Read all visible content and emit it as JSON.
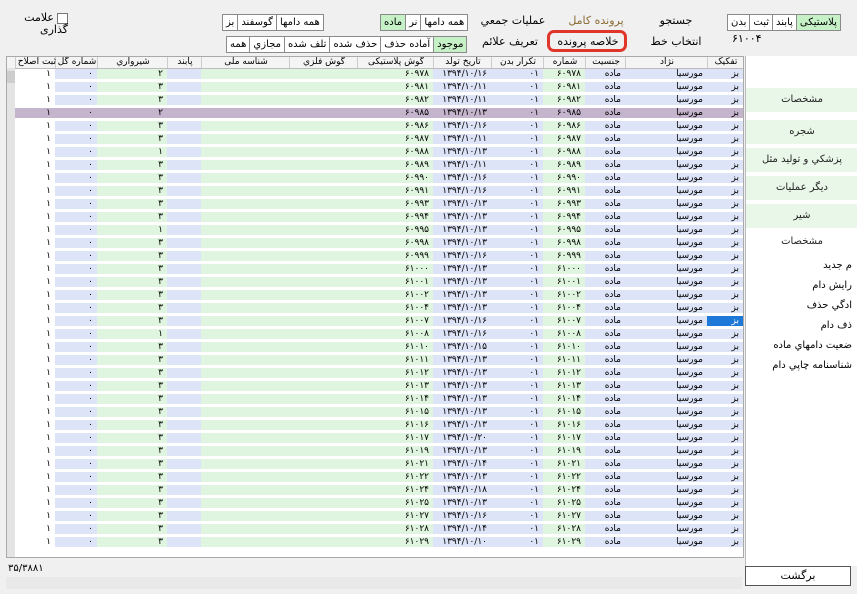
{
  "mark_checkbox": "علامت گذاری",
  "filters": {
    "herd": [
      {
        "label": "همه دامها",
        "selected": false
      },
      {
        "label": "نر",
        "selected": false
      },
      {
        "label": "ماده",
        "selected": true
      }
    ],
    "species": [
      {
        "label": "همه دامها",
        "selected": true
      },
      {
        "label": "گوسفند",
        "selected": false
      },
      {
        "label": "بز",
        "selected": false
      }
    ],
    "status": [
      {
        "label": "موجود",
        "selected": true
      },
      {
        "label": "آماده حذف",
        "selected": false
      },
      {
        "label": "حذف شده",
        "selected": false
      },
      {
        "label": "تلف شده",
        "selected": false
      },
      {
        "label": "مجازي",
        "selected": false
      },
      {
        "label": "همه",
        "selected": false
      }
    ],
    "tag_type": [
      {
        "label": "پلاستیکی",
        "selected": true
      },
      {
        "label": "پابند",
        "selected": false
      },
      {
        "label": "ثبت",
        "selected": false
      },
      {
        "label": "بدن",
        "selected": false
      }
    ]
  },
  "top_buttons": {
    "search": "جستجو",
    "full_record": "پرونده کامل",
    "bulk_ops": "عملیات جمعي",
    "select_line": "انتخاب خط",
    "record_summary": "خلاصه پرونده",
    "define_signs": "تعریف علائم"
  },
  "search_id": "۶۱۰۰۴",
  "columns": [
    "تفکیک",
    "نژاد",
    "جنسیت",
    "شماره",
    "تکرار بدن",
    "تاریخ تولد",
    "گوش پلاستیکی",
    "گوش فلزي",
    "شناسه ملی",
    "پابند",
    "شیرواري",
    "شماره گل",
    "ثبت اصلاح ..."
  ],
  "rows": [
    {
      "sp": "بز",
      "breed": "مورسیا",
      "sex": "ماده",
      "num": "۶۰۹۷۸",
      "rep": "۰۱",
      "birth": "۱۳۹۴/۱۰/۱۶",
      "plastic": "۶۰۹۷۸",
      "milk": "۲",
      "nose": "۰",
      "reg": "۱"
    },
    {
      "sp": "بز",
      "breed": "مورسیا",
      "sex": "ماده",
      "num": "۶۰۹۸۱",
      "rep": "۰۱",
      "birth": "۱۳۹۴/۱۰/۱۱",
      "plastic": "۶۰۹۸۱",
      "milk": "۳",
      "nose": "۰",
      "reg": "۱"
    },
    {
      "sp": "بز",
      "breed": "مورسیا",
      "sex": "ماده",
      "num": "۶۰۹۸۲",
      "rep": "۰۱",
      "birth": "۱۳۹۴/۱۰/۱۱",
      "plastic": "۶۰۹۸۲",
      "milk": "۳",
      "nose": "۰",
      "reg": "۱"
    },
    {
      "sp": "بز",
      "breed": "مورسیا",
      "sex": "ماده",
      "num": "۶۰۹۸۵",
      "rep": "۰۱",
      "birth": "۱۳۹۴/۱۰/۱۳",
      "plastic": "۶۰۹۸۵",
      "milk": "۲",
      "nose": "۰",
      "reg": "۱"
    },
    {
      "sp": "بز",
      "breed": "مورسیا",
      "sex": "ماده",
      "num": "۶۰۹۸۶",
      "rep": "۰۱",
      "birth": "۱۳۹۴/۱۰/۱۶",
      "plastic": "۶۰۹۸۶",
      "milk": "۳",
      "nose": "۰",
      "reg": "۱"
    },
    {
      "sp": "بز",
      "breed": "مورسیا",
      "sex": "ماده",
      "num": "۶۰۹۸۷",
      "rep": "۰۱",
      "birth": "۱۳۹۴/۱۰/۱۱",
      "plastic": "۶۰۹۸۷",
      "milk": "۳",
      "nose": "۰",
      "reg": "۱"
    },
    {
      "sp": "بز",
      "breed": "مورسیا",
      "sex": "ماده",
      "num": "۶۰۹۸۸",
      "rep": "۰۱",
      "birth": "۱۳۹۴/۱۰/۱۳",
      "plastic": "۶۰۹۸۸",
      "milk": "۱",
      "nose": "۰",
      "reg": "۱"
    },
    {
      "sp": "بز",
      "breed": "مورسیا",
      "sex": "ماده",
      "num": "۶۰۹۸۹",
      "rep": "۰۱",
      "birth": "۱۳۹۴/۱۰/۱۱",
      "plastic": "۶۰۹۸۹",
      "milk": "۳",
      "nose": "۰",
      "reg": "۱"
    },
    {
      "sp": "بز",
      "breed": "مورسیا",
      "sex": "ماده",
      "num": "۶۰۹۹۰",
      "rep": "۰۱",
      "birth": "۱۳۹۴/۱۰/۱۶",
      "plastic": "۶۰۹۹۰",
      "milk": "۳",
      "nose": "۰",
      "reg": "۱"
    },
    {
      "sp": "بز",
      "breed": "مورسیا",
      "sex": "ماده",
      "num": "۶۰۹۹۱",
      "rep": "۰۱",
      "birth": "۱۳۹۴/۱۰/۱۶",
      "plastic": "۶۰۹۹۱",
      "milk": "۳",
      "nose": "۰",
      "reg": "۱"
    },
    {
      "sp": "بز",
      "breed": "مورسیا",
      "sex": "ماده",
      "num": "۶۰۹۹۳",
      "rep": "۰۱",
      "birth": "۱۳۹۴/۱۰/۱۳",
      "plastic": "۶۰۹۹۳",
      "milk": "۳",
      "nose": "۰",
      "reg": "۱"
    },
    {
      "sp": "بز",
      "breed": "مورسیا",
      "sex": "ماده",
      "num": "۶۰۹۹۴",
      "rep": "۰۱",
      "birth": "۱۳۹۴/۱۰/۱۳",
      "plastic": "۶۰۹۹۴",
      "milk": "۳",
      "nose": "۰",
      "reg": "۱"
    },
    {
      "sp": "بز",
      "breed": "مورسیا",
      "sex": "ماده",
      "num": "۶۰۹۹۵",
      "rep": "۰۱",
      "birth": "۱۳۹۴/۱۰/۱۳",
      "plastic": "۶۰۹۹۵",
      "milk": "۱",
      "nose": "۰",
      "reg": "۱"
    },
    {
      "sp": "بز",
      "breed": "مورسیا",
      "sex": "ماده",
      "num": "۶۰۹۹۸",
      "rep": "۰۱",
      "birth": "۱۳۹۴/۱۰/۱۳",
      "plastic": "۶۰۹۹۸",
      "milk": "۳",
      "nose": "۰",
      "reg": "۱"
    },
    {
      "sp": "بز",
      "breed": "مورسیا",
      "sex": "ماده",
      "num": "۶۰۹۹۹",
      "rep": "۰۱",
      "birth": "۱۳۹۴/۱۰/۱۶",
      "plastic": "۶۰۹۹۹",
      "milk": "۳",
      "nose": "۰",
      "reg": "۱"
    },
    {
      "sp": "بز",
      "breed": "مورسیا",
      "sex": "ماده",
      "num": "۶۱۰۰۰",
      "rep": "۰۱",
      "birth": "۱۳۹۴/۱۰/۱۳",
      "plastic": "۶۱۰۰۰",
      "milk": "۳",
      "nose": "۰",
      "reg": "۱"
    },
    {
      "sp": "بز",
      "breed": "مورسیا",
      "sex": "ماده",
      "num": "۶۱۰۰۱",
      "rep": "۰۱",
      "birth": "۱۳۹۴/۱۰/۱۳",
      "plastic": "۶۱۰۰۱",
      "milk": "۳",
      "nose": "۰",
      "reg": "۱"
    },
    {
      "sp": "بز",
      "breed": "مورسیا",
      "sex": "ماده",
      "num": "۶۱۰۰۲",
      "rep": "۰۱",
      "birth": "۱۳۹۴/۱۰/۱۳",
      "plastic": "۶۱۰۰۲",
      "milk": "۳",
      "nose": "۰",
      "reg": "۱"
    },
    {
      "sp": "بز",
      "breed": "مورسیا",
      "sex": "ماده",
      "num": "۶۱۰۰۴",
      "rep": "۰۱",
      "birth": "۱۳۹۴/۱۰/۱۳",
      "plastic": "۶۱۰۰۴",
      "milk": "۳",
      "nose": "۰",
      "reg": "۱"
    },
    {
      "sp": "بز",
      "breed": "مورسیا",
      "sex": "ماده",
      "num": "۶۱۰۰۷",
      "rep": "۰۱",
      "birth": "۱۳۹۴/۱۰/۱۶",
      "plastic": "۶۱۰۰۷",
      "milk": "۳",
      "nose": "۰",
      "reg": "۱"
    },
    {
      "sp": "بز",
      "breed": "مورسیا",
      "sex": "ماده",
      "num": "۶۱۰۰۸",
      "rep": "۰۱",
      "birth": "۱۳۹۴/۱۰/۱۶",
      "plastic": "۶۱۰۰۸",
      "milk": "۱",
      "nose": "۰",
      "reg": "۱"
    },
    {
      "sp": "بز",
      "breed": "مورسیا",
      "sex": "ماده",
      "num": "۶۱۰۱۰",
      "rep": "۰۱",
      "birth": "۱۳۹۴/۱۰/۱۵",
      "plastic": "۶۱۰۱۰",
      "milk": "۳",
      "nose": "۰",
      "reg": "۱"
    },
    {
      "sp": "بز",
      "breed": "مورسیا",
      "sex": "ماده",
      "num": "۶۱۰۱۱",
      "rep": "۰۱",
      "birth": "۱۳۹۴/۱۰/۱۳",
      "plastic": "۶۱۰۱۱",
      "milk": "۳",
      "nose": "۰",
      "reg": "۱"
    },
    {
      "sp": "بز",
      "breed": "مورسیا",
      "sex": "ماده",
      "num": "۶۱۰۱۲",
      "rep": "۰۱",
      "birth": "۱۳۹۴/۱۰/۱۳",
      "plastic": "۶۱۰۱۲",
      "milk": "۳",
      "nose": "۰",
      "reg": "۱"
    },
    {
      "sp": "بز",
      "breed": "مورسیا",
      "sex": "ماده",
      "num": "۶۱۰۱۳",
      "rep": "۰۱",
      "birth": "۱۳۹۴/۱۰/۱۳",
      "plastic": "۶۱۰۱۳",
      "milk": "۳",
      "nose": "۰",
      "reg": "۱"
    },
    {
      "sp": "بز",
      "breed": "مورسیا",
      "sex": "ماده",
      "num": "۶۱۰۱۴",
      "rep": "۰۱",
      "birth": "۱۳۹۴/۱۰/۱۳",
      "plastic": "۶۱۰۱۴",
      "milk": "۳",
      "nose": "۰",
      "reg": "۱"
    },
    {
      "sp": "بز",
      "breed": "مورسیا",
      "sex": "ماده",
      "num": "۶۱۰۱۵",
      "rep": "۰۱",
      "birth": "۱۳۹۴/۱۰/۱۳",
      "plastic": "۶۱۰۱۵",
      "milk": "۳",
      "nose": "۰",
      "reg": "۱"
    },
    {
      "sp": "بز",
      "breed": "مورسیا",
      "sex": "ماده",
      "num": "۶۱۰۱۶",
      "rep": "۰۱",
      "birth": "۱۳۹۴/۱۰/۱۳",
      "plastic": "۶۱۰۱۶",
      "milk": "۳",
      "nose": "۰",
      "reg": "۱"
    },
    {
      "sp": "بز",
      "breed": "مورسیا",
      "sex": "ماده",
      "num": "۶۱۰۱۷",
      "rep": "۰۱",
      "birth": "۱۳۹۴/۱۰/۲۰",
      "plastic": "۶۱۰۱۷",
      "milk": "۳",
      "nose": "۰",
      "reg": "۱"
    },
    {
      "sp": "بز",
      "breed": "مورسیا",
      "sex": "ماده",
      "num": "۶۱۰۱۹",
      "rep": "۰۱",
      "birth": "۱۳۹۴/۱۰/۱۳",
      "plastic": "۶۱۰۱۹",
      "milk": "۳",
      "nose": "۰",
      "reg": "۱"
    },
    {
      "sp": "بز",
      "breed": "مورسیا",
      "sex": "ماده",
      "num": "۶۱۰۲۱",
      "rep": "۰۱",
      "birth": "۱۳۹۴/۱۰/۱۴",
      "plastic": "۶۱۰۲۱",
      "milk": "۳",
      "nose": "۰",
      "reg": "۱"
    },
    {
      "sp": "بز",
      "breed": "مورسیا",
      "sex": "ماده",
      "num": "۶۱۰۲۲",
      "rep": "۰۱",
      "birth": "۱۳۹۴/۱۰/۱۳",
      "plastic": "۶۱۰۲۲",
      "milk": "۳",
      "nose": "۰",
      "reg": "۱"
    },
    {
      "sp": "بز",
      "breed": "مورسیا",
      "sex": "ماده",
      "num": "۶۱۰۲۴",
      "rep": "۰۱",
      "birth": "۱۳۹۴/۱۰/۱۸",
      "plastic": "۶۱۰۲۴",
      "milk": "۳",
      "nose": "۰",
      "reg": "۱"
    },
    {
      "sp": "بز",
      "breed": "مورسیا",
      "sex": "ماده",
      "num": "۶۱۰۲۵",
      "rep": "۰۱",
      "birth": "۱۳۹۴/۱۰/۱۳",
      "plastic": "۶۱۰۲۵",
      "milk": "۳",
      "nose": "۰",
      "reg": "۱"
    },
    {
      "sp": "بز",
      "breed": "مورسیا",
      "sex": "ماده",
      "num": "۶۱۰۲۷",
      "rep": "۰۱",
      "birth": "۱۳۹۴/۱۰/۱۶",
      "plastic": "۶۱۰۲۷",
      "milk": "۳",
      "nose": "۰",
      "reg": "۱"
    },
    {
      "sp": "بز",
      "breed": "مورسیا",
      "sex": "ماده",
      "num": "۶۱۰۲۸",
      "rep": "۰۱",
      "birth": "۱۳۹۴/۱۰/۱۴",
      "plastic": "۶۱۰۲۸",
      "milk": "۳",
      "nose": "۰",
      "reg": "۱"
    },
    {
      "sp": "بز",
      "breed": "مورسیا",
      "sex": "ماده",
      "num": "۶۱۰۲۹",
      "rep": "۰۱",
      "birth": "۱۳۹۴/۱۰/۱۰",
      "plastic": "۶۱۰۲۹",
      "milk": "۳",
      "nose": "۰",
      "reg": "۱"
    }
  ],
  "selected_row_index": 3,
  "selected_cell_row_index": 19,
  "right_panel": {
    "buttons": [
      "مشخصات",
      "شجره",
      "پزشکي و تولید مثل",
      "دیگر عملیات",
      "شیر",
      "مشخصات"
    ],
    "links": [
      "م جدید",
      "رایش دام",
      "ادگي حذف",
      "ذف دام",
      "ضعیت دامهاي ماده",
      "شناسنامه چاپي دام"
    ]
  },
  "back_button": "برگشت",
  "record_count": "۳۵/۳۸۸۱",
  "colors": {
    "accent_green": "#c6f0c6",
    "selection_blue": "#1e78d7",
    "selected_row": "#c4b4cc",
    "highlight_red": "#e0362a"
  }
}
